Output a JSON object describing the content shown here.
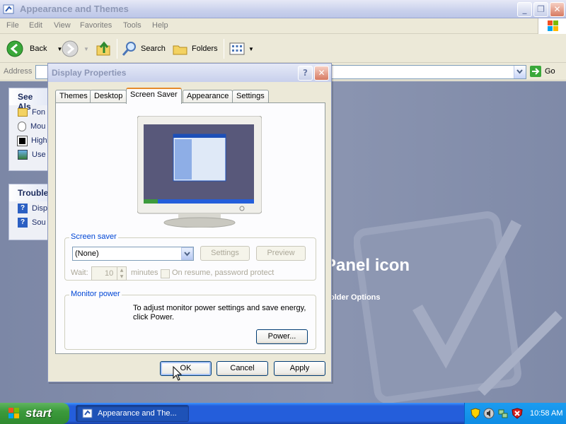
{
  "explorer": {
    "title": "Appearance and Themes",
    "menu": [
      "File",
      "Edit",
      "View",
      "Favorites",
      "Tools",
      "Help"
    ],
    "toolbar": {
      "back_label": "Back",
      "search_label": "Search",
      "folders_label": "Folders"
    },
    "address_label": "Address",
    "go_label": "Go",
    "side_panels": [
      {
        "title": "See Als",
        "items": [
          "Fon",
          "Mou",
          "High",
          "Use"
        ]
      },
      {
        "title": "Trouble",
        "items": [
          "Disp",
          "Sou"
        ]
      }
    ],
    "heading_fragment": "Panel icon",
    "link_fragment": "older Options"
  },
  "dialog": {
    "title": "Display Properties",
    "tabs": [
      "Themes",
      "Desktop",
      "Screen Saver",
      "Appearance",
      "Settings"
    ],
    "active_tab": "Screen Saver",
    "screensaver": {
      "legend": "Screen saver",
      "selected": "(None)",
      "settings_label": "Settings",
      "preview_label": "Preview",
      "wait_label": "Wait:",
      "wait_value": "10",
      "minutes_label": "minutes",
      "resume_label": "On resume, password protect"
    },
    "monitor_power": {
      "legend": "Monitor power",
      "text": "To adjust monitor power settings and save energy, click Power.",
      "power_label": "Power..."
    },
    "buttons": {
      "ok": "OK",
      "cancel": "Cancel",
      "apply": "Apply"
    }
  },
  "taskbar": {
    "start_label": "start",
    "task_label": "Appearance and The...",
    "clock": "10:58 AM"
  },
  "colors": {
    "accent_tab": "#e68b2c",
    "taskbar": "#245edb",
    "start": "#3c9a3c",
    "legend": "#0046d5"
  }
}
